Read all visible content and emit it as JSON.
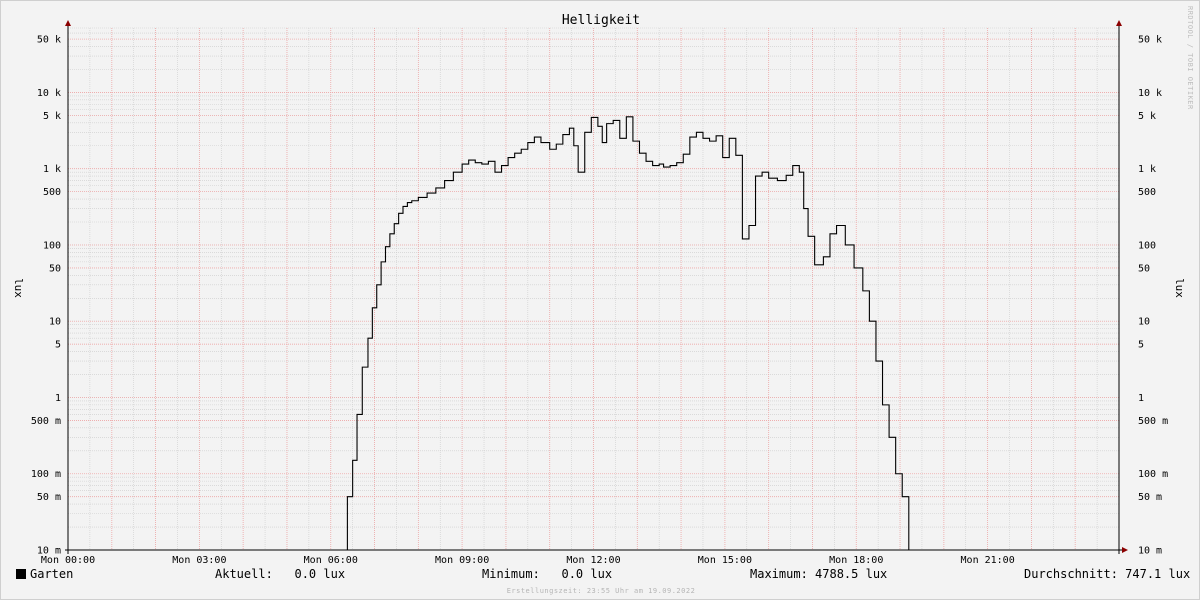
{
  "watermark": "RRDTOOL / TOBI OETIKER",
  "footer": "Erstellungszeit: 23:55 Uhr am 19.09.2022",
  "legend": {
    "series_label": "Garten",
    "current_label": "Aktuell:",
    "current_value": "0.0 lux",
    "min_label": "Minimum:",
    "min_value": "0.0 lux",
    "max_label": "Maximum:",
    "max_value": "4788.5 lux",
    "avg_label": "Durchschnitt:",
    "avg_value": "747.1 lux"
  },
  "colors": {
    "line": "#000000",
    "major_grid": "#f0a8a8",
    "minor_grid": "#cccccc",
    "axis": "#000000",
    "arrow": "#8b0000"
  },
  "chart_data": {
    "type": "line",
    "title": "Helligkeit",
    "ylabel": "lux",
    "ylabel_right": "lux",
    "yscale": "log",
    "ylim": [
      0.01,
      70000
    ],
    "xlim": [
      0,
      24
    ],
    "grid": true,
    "x_ticks": [
      {
        "x": 0,
        "label": "Mon 00:00"
      },
      {
        "x": 3,
        "label": "Mon 03:00"
      },
      {
        "x": 6,
        "label": "Mon 06:00"
      },
      {
        "x": 9,
        "label": "Mon 09:00"
      },
      {
        "x": 12,
        "label": "Mon 12:00"
      },
      {
        "x": 15,
        "label": "Mon 15:00"
      },
      {
        "x": 18,
        "label": "Mon 18:00"
      },
      {
        "x": 21,
        "label": "Mon 21:00"
      }
    ],
    "y_ticks": [
      {
        "v": 50000,
        "label": "50 k"
      },
      {
        "v": 10000,
        "label": "10 k"
      },
      {
        "v": 5000,
        "label": "5 k"
      },
      {
        "v": 1000,
        "label": "1 k"
      },
      {
        "v": 500,
        "label": "500"
      },
      {
        "v": 100,
        "label": "100"
      },
      {
        "v": 50,
        "label": "50"
      },
      {
        "v": 10,
        "label": "10"
      },
      {
        "v": 5,
        "label": "5"
      },
      {
        "v": 1,
        "label": "1"
      },
      {
        "v": 0.5,
        "label": "500 m"
      },
      {
        "v": 0.1,
        "label": "100 m"
      },
      {
        "v": 0.05,
        "label": "50 m"
      },
      {
        "v": 0.01,
        "label": "10 m"
      }
    ],
    "series": [
      {
        "name": "Garten",
        "step": true,
        "x": [
          0,
          6.38,
          6.5,
          6.6,
          6.72,
          6.85,
          6.95,
          7.05,
          7.15,
          7.25,
          7.35,
          7.45,
          7.55,
          7.65,
          7.75,
          7.85,
          8.0,
          8.2,
          8.4,
          8.6,
          8.8,
          9.0,
          9.15,
          9.3,
          9.45,
          9.6,
          9.75,
          9.9,
          10.05,
          10.2,
          10.35,
          10.5,
          10.65,
          10.8,
          11.0,
          11.15,
          11.3,
          11.45,
          11.55,
          11.65,
          11.8,
          11.95,
          12.1,
          12.2,
          12.3,
          12.45,
          12.6,
          12.75,
          12.9,
          13.05,
          13.2,
          13.35,
          13.5,
          13.6,
          13.75,
          13.9,
          14.05,
          14.2,
          14.35,
          14.5,
          14.65,
          14.8,
          14.95,
          15.1,
          15.25,
          15.4,
          15.55,
          15.7,
          15.85,
          16.0,
          16.2,
          16.4,
          16.55,
          16.7,
          16.8,
          16.9,
          17.05,
          17.25,
          17.4,
          17.55,
          17.75,
          17.95,
          18.15,
          18.3,
          18.45,
          18.6,
          18.75,
          18.9,
          19.05,
          19.2,
          19.3,
          19.45,
          19.6,
          19.75,
          19.9,
          20.0,
          20.1,
          20.2,
          20.35,
          20.45,
          20.55,
          20.65,
          20.75,
          20.85,
          20.95,
          21.0,
          21.4,
          23.0
        ],
        "values": [
          0.01,
          0.05,
          0.15,
          0.6,
          2.5,
          6,
          15,
          30,
          60,
          95,
          140,
          190,
          260,
          320,
          360,
          380,
          420,
          480,
          560,
          700,
          900,
          1150,
          1300,
          1200,
          1150,
          1250,
          900,
          1100,
          1400,
          1600,
          1800,
          2200,
          2600,
          2200,
          1800,
          2100,
          2800,
          3400,
          2000,
          900,
          3000,
          4700,
          3600,
          2200,
          3900,
          4300,
          2500,
          4788,
          2300,
          1600,
          1250,
          1100,
          1150,
          1050,
          1100,
          1200,
          1550,
          2600,
          3000,
          2500,
          2300,
          2700,
          1400,
          2500,
          1500,
          120,
          180,
          800,
          900,
          750,
          700,
          820,
          1100,
          900,
          300,
          130,
          55,
          70,
          140,
          180,
          100,
          50,
          25,
          10,
          3,
          0.8,
          0.3,
          0.1,
          0.05,
          0.01,
          0.01,
          0.01,
          0.01,
          0.01,
          0.01,
          0.01,
          0.01,
          0.01,
          0.01,
          0.01,
          0.01,
          0.01,
          0.01,
          0.01,
          0.01,
          0.01,
          0.01,
          0.01
        ]
      }
    ]
  }
}
